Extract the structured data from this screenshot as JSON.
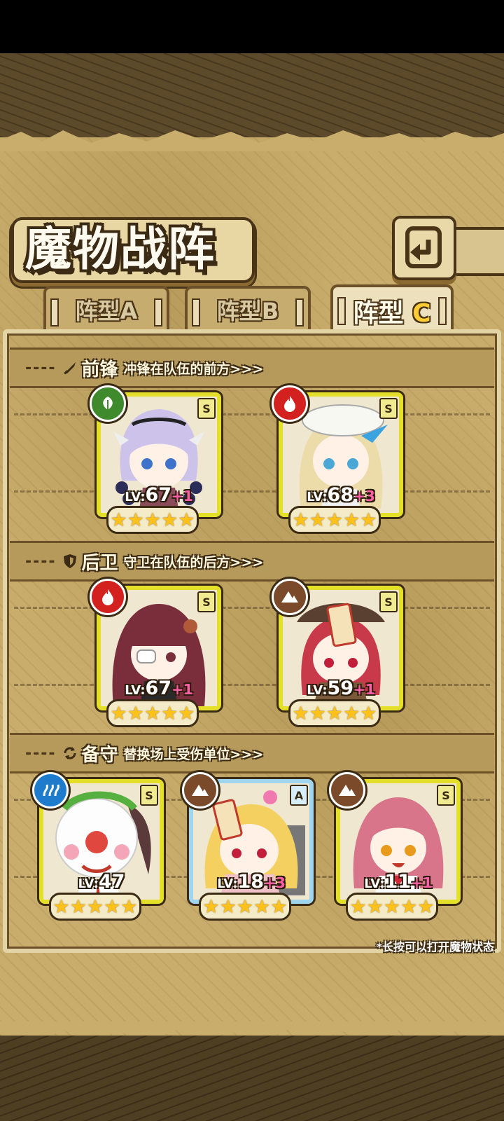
{
  "title": "魔物战阵",
  "tabs": [
    {
      "prefix": "阵型",
      "letter": "A",
      "active": false
    },
    {
      "prefix": "阵型",
      "letter": "B",
      "active": false
    },
    {
      "prefix": "阵型",
      "letter": "C",
      "active": true
    }
  ],
  "sections": {
    "vanguard": {
      "name": "前锋",
      "desc": "冲锋在队伍的前方>>>",
      "icon": "sword-icon"
    },
    "rearguard": {
      "name": "后卫",
      "desc": "守卫在队伍的后方>>>",
      "icon": "shield-icon"
    },
    "reserve": {
      "name": "备守",
      "desc": "替换场上受伤单位>>>",
      "icon": "swap-icon"
    }
  },
  "units": {
    "vanguard": [
      {
        "rank": "S",
        "element": "leaf-icon",
        "element_color": "#3f8a2c",
        "lv_prefix": "LV:",
        "lv": "67",
        "plus": "+1",
        "stars": "★★★★★"
      },
      {
        "rank": "S",
        "element": "fire-icon",
        "element_color": "#d2211f",
        "lv_prefix": "LV:",
        "lv": "68",
        "plus": "+3",
        "stars": "★★★★★"
      }
    ],
    "rearguard": [
      {
        "rank": "S",
        "element": "fire-icon",
        "element_color": "#d2211f",
        "lv_prefix": "LV:",
        "lv": "67",
        "plus": "+1",
        "stars": "★★★★★"
      },
      {
        "rank": "S",
        "element": "earth-icon",
        "element_color": "#7a4a2a",
        "lv_prefix": "LV:",
        "lv": "59",
        "plus": "+1",
        "stars": "★★★★★"
      }
    ],
    "reserve": [
      {
        "rank": "S",
        "element": "water-icon",
        "element_color": "#1f7ccc",
        "lv_prefix": "LV:",
        "lv": "47",
        "plus": "",
        "stars": "★★★★★"
      },
      {
        "rank": "A",
        "element": "earth-icon",
        "element_color": "#7a4a2a",
        "lv_prefix": "LV:",
        "lv": "18",
        "plus": "+3",
        "stars": "★★★★★"
      },
      {
        "rank": "S",
        "element": "earth-icon",
        "element_color": "#7a4a2a",
        "lv_prefix": "LV:",
        "lv": "11",
        "plus": "+1",
        "stars": "★★★★★"
      }
    ]
  },
  "hint": "*长按可以打开魔物状态",
  "back_button": {
    "icon": "back-arrow-icon"
  }
}
